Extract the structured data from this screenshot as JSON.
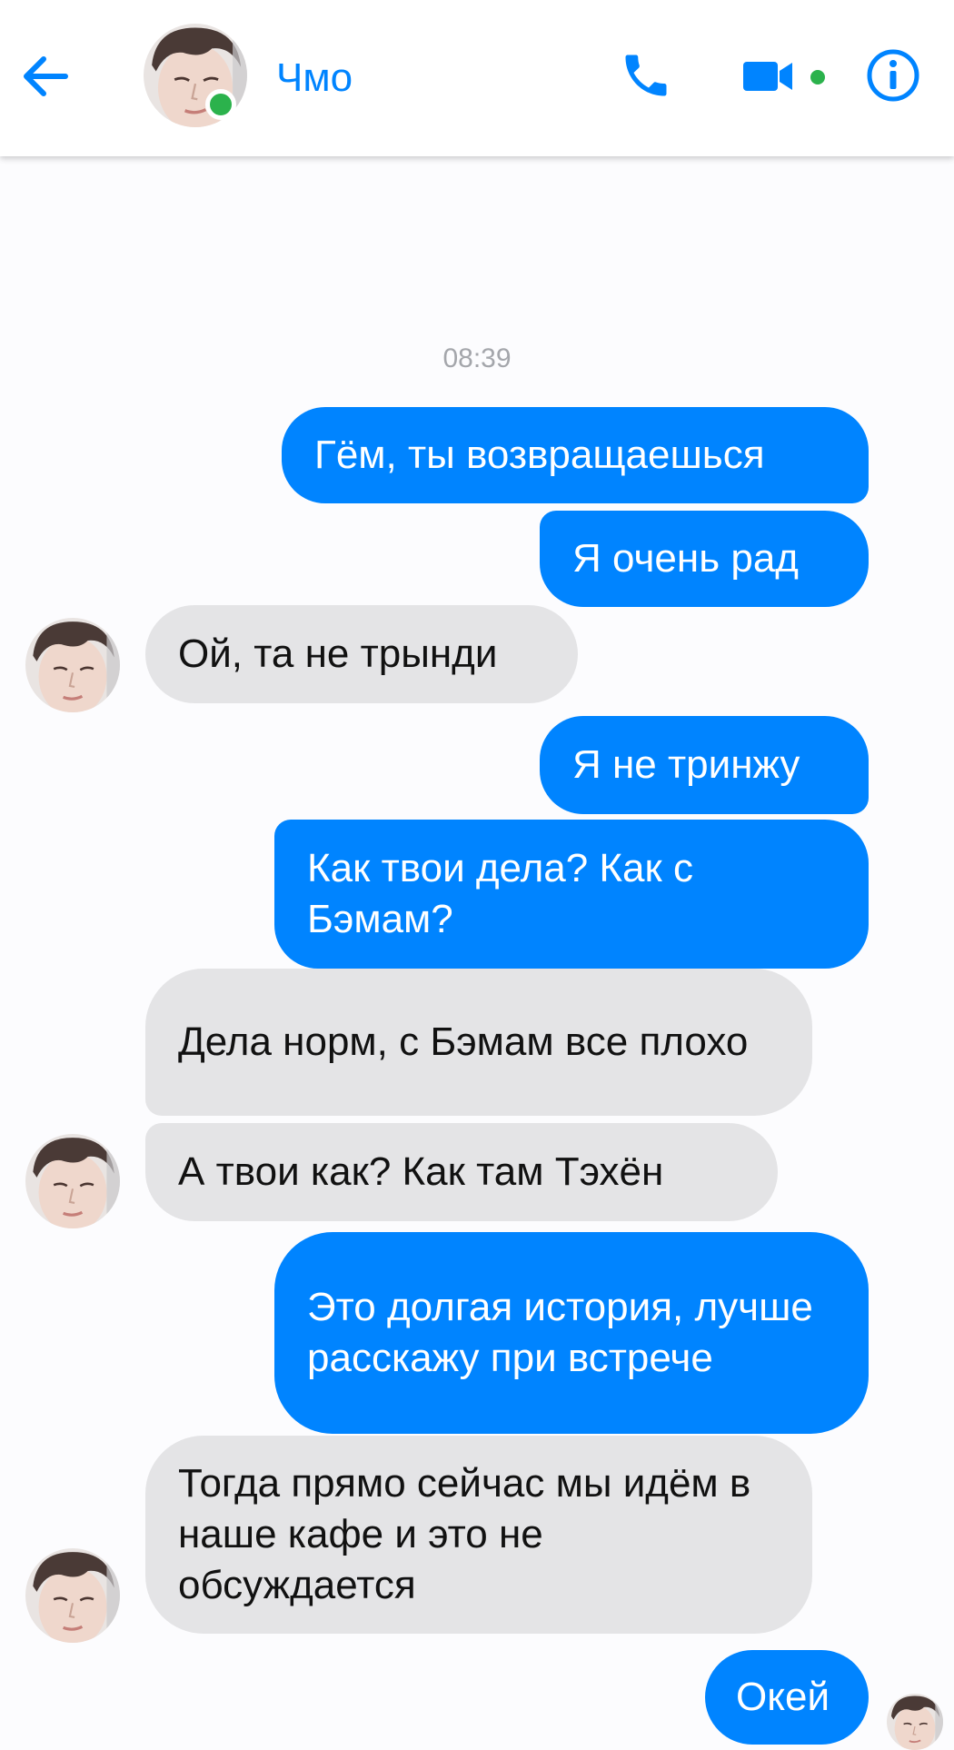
{
  "header": {
    "contact_name": "Чмо",
    "back_icon": "arrow-left-icon",
    "call_icon": "phone-icon",
    "video_icon": "video-camera-icon",
    "info_icon": "info-icon",
    "accent_color": "#0084ff",
    "online_color": "#2bb24c"
  },
  "conversation": {
    "timestamp": "08:39",
    "messages": [
      {
        "direction": "outgoing",
        "text": "Гём, ты возвращаешься"
      },
      {
        "direction": "outgoing",
        "text": "Я очень рад"
      },
      {
        "direction": "incoming",
        "text": "Ой, та не трынди"
      },
      {
        "direction": "outgoing",
        "text": "Я не тринжу"
      },
      {
        "direction": "outgoing",
        "text": "Как твои дела? Как с Бэмам?"
      },
      {
        "direction": "incoming",
        "text": "Дела норм, с Бэмам все плохо"
      },
      {
        "direction": "incoming",
        "text": "А твои как? Как там Тэхён"
      },
      {
        "direction": "outgoing",
        "text": "Это долгая история, лучше расскажу при встрече"
      },
      {
        "direction": "incoming",
        "text": "Тогда прямо сейчас мы идём в наше кафе и это не обсуждается"
      },
      {
        "direction": "outgoing",
        "text": "Окей"
      }
    ]
  },
  "colors": {
    "outgoing_bubble": "#0084ff",
    "incoming_bubble": "#e4e4e6",
    "background": "#fcfcfe",
    "timestamp": "#a4a6ab"
  }
}
